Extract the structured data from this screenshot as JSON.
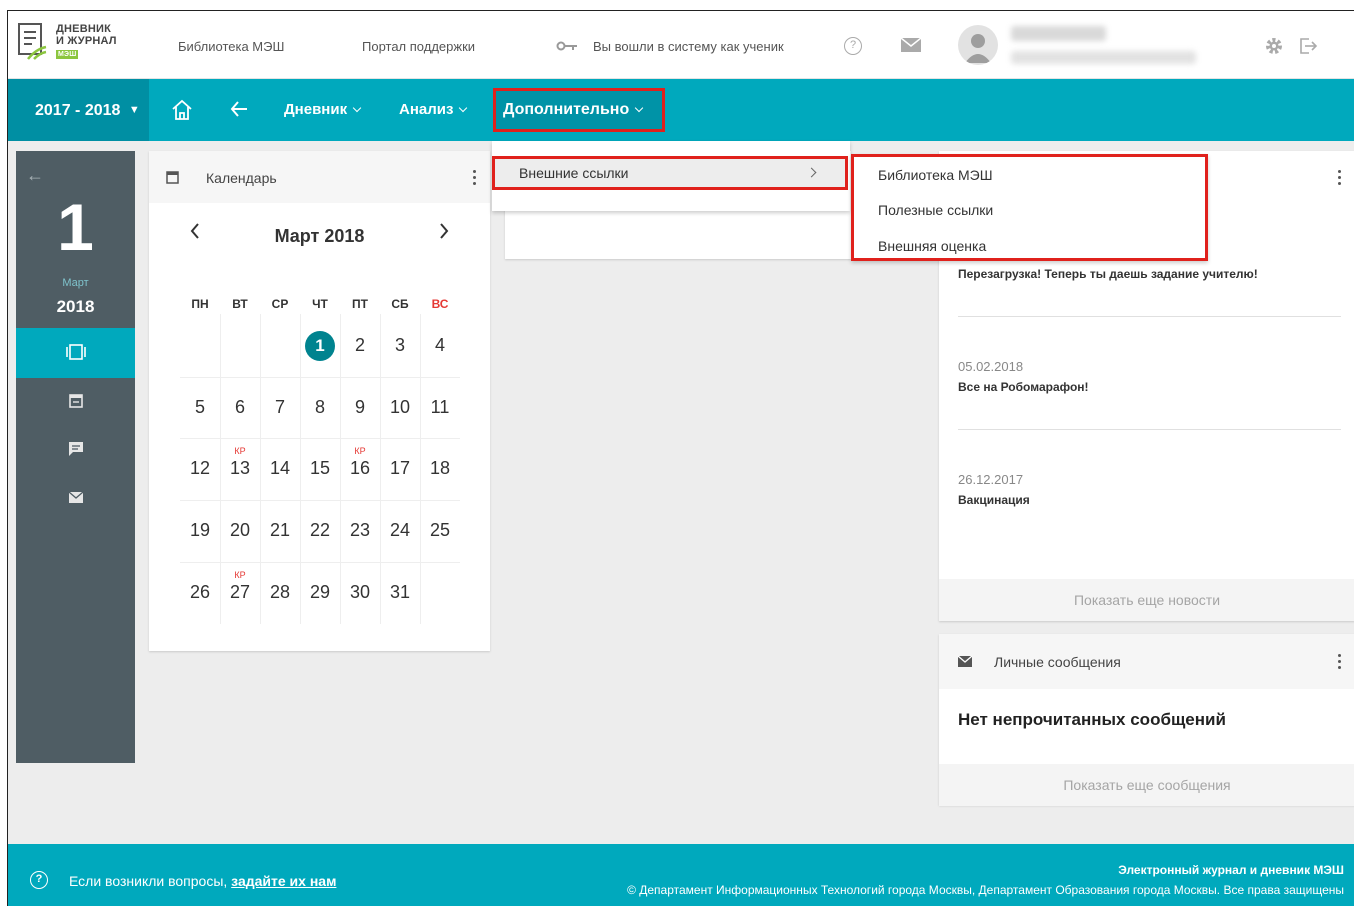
{
  "header": {
    "logo_line1": "ДНЕВНИК",
    "logo_line2": "И ЖУРНАЛ",
    "logo_badge": "МЭШ",
    "library_link": "Библиотека МЭШ",
    "support_link": "Портал поддержки",
    "login_status": "Вы вошли в систему как ученик",
    "help_symbol": "?"
  },
  "nav": {
    "year": "2017 - 2018",
    "diary": "Дневник",
    "analysis": "Анализ",
    "extra": "Дополнительно"
  },
  "dropdown": {
    "external_links": "Внешние ссылки",
    "submenu": [
      "Библиотека МЭШ",
      "Полезные ссылки",
      "Внешняя оценка"
    ]
  },
  "sidebar": {
    "back_arrow": "←",
    "day": "1",
    "month": "Март",
    "year": "2018"
  },
  "calendar": {
    "title": "Календарь",
    "month_label": "Март 2018",
    "weekdays": [
      "ПН",
      "ВТ",
      "СР",
      "ЧТ",
      "ПТ",
      "СБ",
      "ВС"
    ],
    "prev": "‹",
    "next": "›",
    "today": "1",
    "kr_label": "КР",
    "days": [
      "2",
      "3",
      "4",
      "5",
      "6",
      "7",
      "8",
      "9",
      "10",
      "11",
      "12",
      "13",
      "14",
      "15",
      "16",
      "17",
      "18",
      "19",
      "20",
      "21",
      "22",
      "23",
      "24",
      "25",
      "26",
      "27",
      "28",
      "29",
      "30",
      "31"
    ]
  },
  "news": {
    "item1_text": "Перезагрузка! Теперь ты даешь задание учителю!",
    "item2_date": "05.02.2018",
    "item2_text": "Все на Робомарафон!",
    "item3_date": "26.12.2017",
    "item3_text": "Вакцинация",
    "more": "Показать еще новости"
  },
  "messages": {
    "title": "Личные сообщения",
    "empty": "Нет непрочитанных сообщений",
    "more": "Показать еще сообщения"
  },
  "footer": {
    "question_prefix": "Если возникли вопросы,",
    "question_link": "задайте их нам",
    "title": "Электронный журнал и дневник МЭШ",
    "copyright": "© Департамент Информационных Технологий города Москвы, Департамент Образования города Москвы. Все права защищены"
  },
  "colors": {
    "teal": "#00a9bd",
    "teal_dark": "#008fa3",
    "sidebar": "#4f5d64",
    "highlight_red": "#e0211c",
    "weekend_red": "#e53935"
  }
}
